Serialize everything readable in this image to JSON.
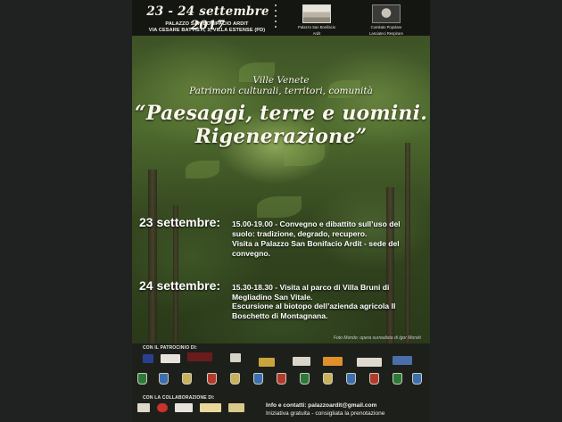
{
  "header": {
    "dates": "23 - 24 settembre 2017",
    "venue_line1": "PALAZZO SAN BONIFACIO ARDIT",
    "venue_line2": "VIA CESARE BATTISTI, 1, VILLA ESTENSE (PD)",
    "logo1_label1": "Palazzo San Bonifacio",
    "logo1_label2": "Ardit",
    "logo2_label1": "Comitato Popolare",
    "logo2_label2": "Lasciateci Respirare"
  },
  "title": {
    "line1": "Ville Venete",
    "line2": "Patrimoni culturali, territori, comunità",
    "main1": "“Paesaggi, terre e uomini.",
    "main2": "Rigenerazione”"
  },
  "program": {
    "day1": "23 settembre:",
    "day1_event1": "15.00-19.00 - Convegno e dibattito sull’uso del suolo: tradizione, degrado, recupero.",
    "day1_event2": "Visita a Palazzo San Bonifacio Ardit - sede del convegno.",
    "day2": "24 settembre:",
    "day2_event1": "15.30-18.30 - Visita al parco di Villa Bruni di Megliadino San Vitale.",
    "day2_event2": "Escursione al biotopo dell’azienda agricola Il Boschetto di Montagnana."
  },
  "credit": "Foto Mondo: opera surrealista di Igor Morski",
  "footer": {
    "patronage_label": "CON IL PATROCINIO DI:",
    "collab_label": "CON LA COLLABORAZIONE DI:",
    "contact_line1": "Info e contatti: palazzoardit@gmail.com",
    "contact_line2": "Iniziativa gratuita - consigliata la prenotazione"
  },
  "colors": {
    "background": "#1f2220",
    "poster_dark": "#171a16",
    "text": "#fbf7ec",
    "foliage": "#4e6a2e"
  }
}
